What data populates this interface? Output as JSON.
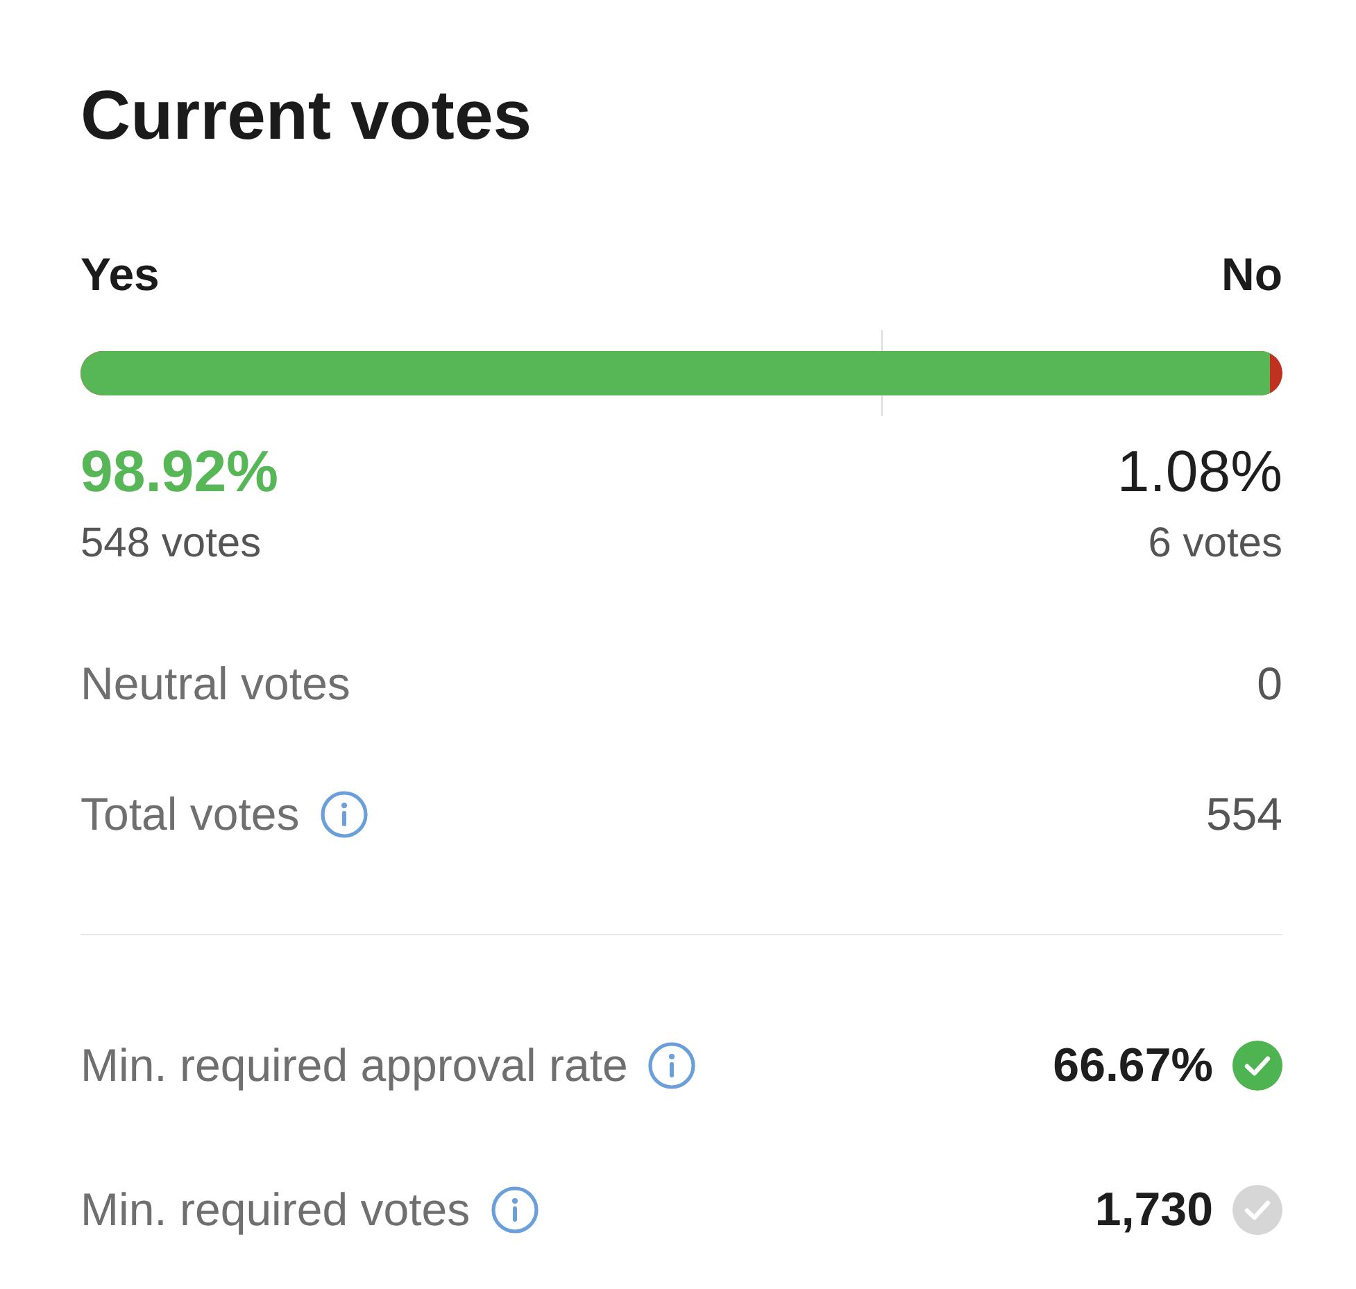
{
  "title": "Current votes",
  "vote_bar": {
    "level": 0.9892,
    "threshold_marker": {
      "level": 0.6667
    }
  },
  "sides": [
    {
      "kind": "yes",
      "label": "Yes",
      "percent": "98.92%",
      "votes": "548 votes"
    },
    {
      "kind": "no",
      "label": "No",
      "percent": "1.08%",
      "votes": "6 votes"
    }
  ],
  "stats": [
    {
      "label": "Neutral votes",
      "info": false,
      "value": "0"
    },
    {
      "label": "Total votes",
      "info": true,
      "value": "554"
    }
  ],
  "requirements": [
    {
      "label": "Min. required approval rate",
      "info": true,
      "value": "66.67%",
      "met": true
    },
    {
      "label": "Min. required votes",
      "info": true,
      "value": "1,730",
      "met": false
    }
  ]
}
